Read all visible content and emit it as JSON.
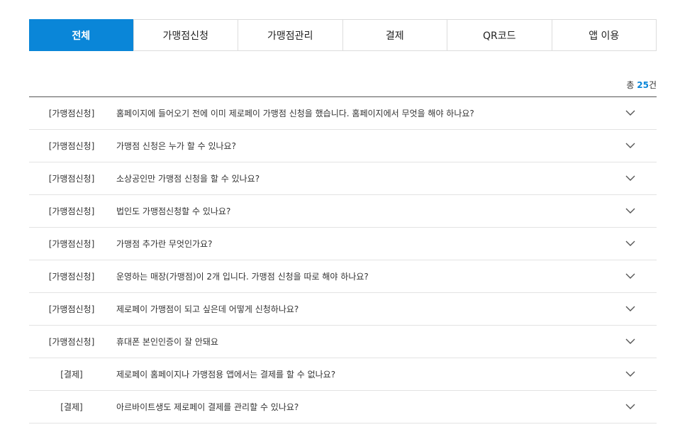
{
  "tabs": [
    {
      "label": "전체",
      "active": true
    },
    {
      "label": "가맹점신청",
      "active": false
    },
    {
      "label": "가맹점관리",
      "active": false
    },
    {
      "label": "결제",
      "active": false
    },
    {
      "label": "QR코드",
      "active": false
    },
    {
      "label": "앱 이용",
      "active": false
    }
  ],
  "count": {
    "prefix": "총 ",
    "value": "25",
    "suffix": "건"
  },
  "faq": [
    {
      "category": "[가맹점신청]",
      "question": "홈페이지에 들어오기 전에 이미 제로페이 가맹점 신청을 했습니다. 홈페이지에서 무엇을 해야 하나요?"
    },
    {
      "category": "[가맹점신청]",
      "question": "가맹점 신청은 누가 할 수 있나요?"
    },
    {
      "category": "[가맹점신청]",
      "question": "소상공인만 가맹점 신청을 할 수 있나요?"
    },
    {
      "category": "[가맹점신청]",
      "question": "법인도 가맹점신청할 수 있나요?"
    },
    {
      "category": "[가맹점신청]",
      "question": "가맹점 추가란 무엇인가요?"
    },
    {
      "category": "[가맹점신청]",
      "question": "운영하는 매장(가맹점)이 2개 입니다. 가맹점 신청을 따로 해야 하나요?"
    },
    {
      "category": "[가맹점신청]",
      "question": "제로페이 가맹점이 되고 싶은데 어떻게 신청하나요?"
    },
    {
      "category": "[가맹점신청]",
      "question": "휴대폰 본인인증이 잘 안돼요"
    },
    {
      "category": "[결제]",
      "question": "제로페이 홈페이지나 가맹점용 앱에서는 결제를 할 수 없나요?"
    },
    {
      "category": "[결제]",
      "question": "아르바이트생도 제로페이 결제를 관리할 수 있나요?"
    }
  ],
  "icons": {
    "expand": "chevron-down-icon"
  },
  "colors": {
    "accent": "#0a86d8"
  }
}
